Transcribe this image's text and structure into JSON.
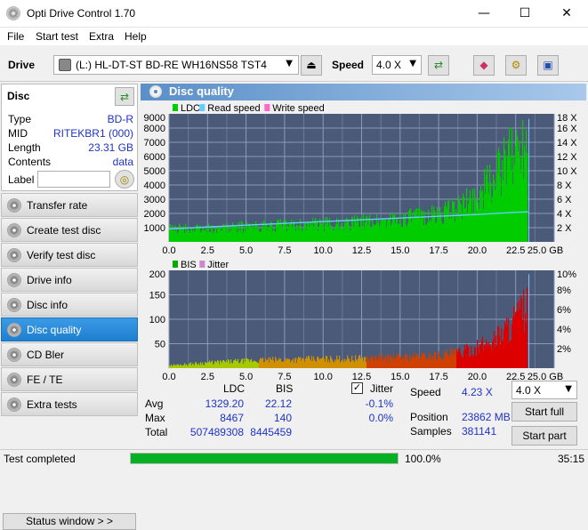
{
  "window": {
    "title": "Opti Drive Control 1.70",
    "minimize": "—",
    "maximize": "☐",
    "close": "✕"
  },
  "menu": [
    "File",
    "Start test",
    "Extra",
    "Help"
  ],
  "toolbar": {
    "drive_label": "Drive",
    "drive_value": "(L:)   HL-DT-ST BD-RE  WH16NS58 TST4",
    "speed_label": "Speed",
    "speed_value": "4.0 X"
  },
  "disc": {
    "title": "Disc",
    "rows": [
      {
        "label": "Type",
        "value": "BD-R"
      },
      {
        "label": "MID",
        "value": "RITEKBR1 (000)"
      },
      {
        "label": "Length",
        "value": "23.31 GB"
      },
      {
        "label": "Contents",
        "value": "data"
      }
    ],
    "label_field": "Label"
  },
  "nav": [
    {
      "label": "Transfer rate",
      "active": false
    },
    {
      "label": "Create test disc",
      "active": false
    },
    {
      "label": "Verify test disc",
      "active": false
    },
    {
      "label": "Drive info",
      "active": false
    },
    {
      "label": "Disc info",
      "active": false
    },
    {
      "label": "Disc quality",
      "active": true
    },
    {
      "label": "CD Bler",
      "active": false
    },
    {
      "label": "FE / TE",
      "active": false
    },
    {
      "label": "Extra tests",
      "active": false
    }
  ],
  "status_window_btn": "Status window > >",
  "panel_title": "Disc quality",
  "chart_data": [
    {
      "type": "area",
      "legend": [
        "LDC",
        "Read speed",
        "Write speed"
      ],
      "x_ticks": [
        "0.0",
        "2.5",
        "5.0",
        "7.5",
        "10.0",
        "12.5",
        "15.0",
        "17.5",
        "20.0",
        "22.5",
        "25.0 GB"
      ],
      "y_ticks_left": [
        "9000",
        "8000",
        "7000",
        "6000",
        "5000",
        "4000",
        "3000",
        "2000",
        "1000"
      ],
      "y_ticks_right": [
        "18 X",
        "16 X",
        "14 X",
        "12 X",
        "10 X",
        "8 X",
        "6 X",
        "4 X",
        "2 X"
      ],
      "xlim": [
        0,
        25
      ],
      "ylim": [
        0,
        9000
      ],
      "ldc_series": {
        "x": [
          0,
          2.5,
          5,
          7.5,
          10,
          12.5,
          15,
          17.5,
          19,
          20,
          21,
          22,
          22.5,
          23,
          23.3
        ],
        "y": [
          1000,
          1000,
          1150,
          1250,
          1350,
          1500,
          1750,
          2100,
          2700,
          3500,
          4700,
          6100,
          7000,
          8000,
          8467
        ]
      },
      "read_speed": {
        "x": [
          0,
          2.5,
          5,
          7.5,
          10,
          12.5,
          15,
          17.5,
          20,
          22.5,
          23.3
        ],
        "y": [
          1.8,
          2.1,
          2.35,
          2.6,
          2.85,
          3.1,
          3.35,
          3.6,
          3.85,
          4.15,
          4.23
        ]
      }
    },
    {
      "type": "area",
      "legend": [
        "BIS",
        "Jitter"
      ],
      "x_ticks": [
        "0.0",
        "2.5",
        "5.0",
        "7.5",
        "10.0",
        "12.5",
        "15.0",
        "17.5",
        "20.0",
        "22.5",
        "25.0 GB"
      ],
      "y_ticks_left": [
        "200",
        "150",
        "100",
        "50"
      ],
      "y_ticks_right": [
        "10%",
        "8%",
        "6%",
        "4%",
        "2%"
      ],
      "xlim": [
        0,
        25
      ],
      "ylim": [
        0,
        200
      ],
      "bis_series": {
        "x": [
          0,
          2.5,
          5,
          7.5,
          10,
          12.5,
          15,
          17.5,
          19,
          20,
          21,
          22,
          22.5,
          23,
          23.3
        ],
        "y": [
          6,
          12,
          16,
          19,
          20,
          21,
          24,
          28,
          35,
          45,
          62,
          90,
          110,
          125,
          140
        ]
      }
    }
  ],
  "stats": {
    "col_ldc": "LDC",
    "col_bis": "BIS",
    "rows": [
      {
        "label": "Avg",
        "ldc": "1329.20",
        "bis": "22.12",
        "jitter": "-0.1%"
      },
      {
        "label": "Max",
        "ldc": "8467",
        "bis": "140",
        "jitter": "0.0%"
      },
      {
        "label": "Total",
        "ldc": "507489308",
        "bis": "8445459",
        "jitter": ""
      }
    ],
    "jitter_label": "Jitter",
    "speed_label": "Speed",
    "speed_value": "4.23 X",
    "position_label": "Position",
    "position_value": "23862 MB",
    "samples_label": "Samples",
    "samples_value": "381141",
    "speed_select": "4.0 X",
    "start_full": "Start full",
    "start_part": "Start part"
  },
  "statusbar": {
    "text": "Test completed",
    "progress": 1.0,
    "progress_text": "100.0%",
    "time": "35:15"
  },
  "colors": {
    "plot_bg": "#4a5a78",
    "ldc": "#00cc00",
    "read": "#66ccff",
    "bis_low": "#a8c800",
    "bis_high": "#dd0000",
    "active_nav": "#2a8ce0"
  }
}
